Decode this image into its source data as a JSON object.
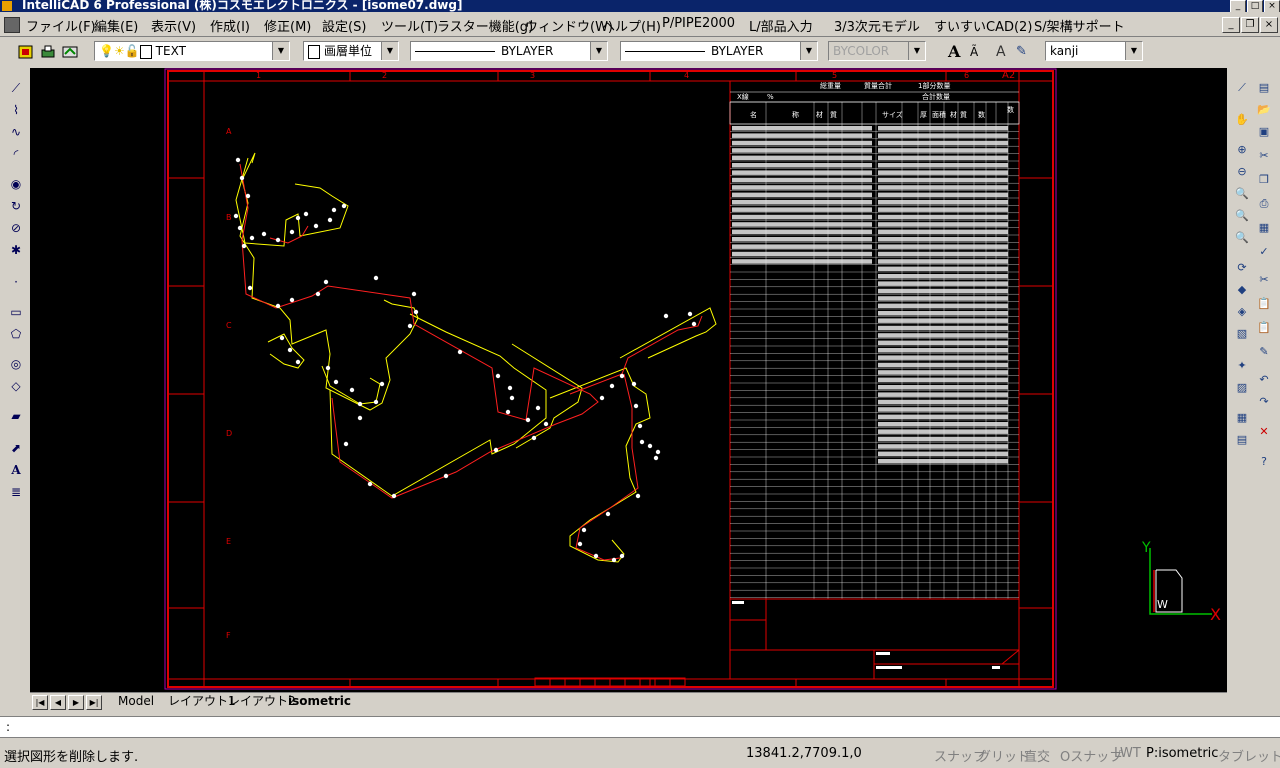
{
  "window": {
    "title": "IntelliCAD 6 Professional (株)コスモエレクトロニクス - [isome07.dwg]"
  },
  "menu": [
    "ファイル(F)",
    "編集(E)",
    "表示(V)",
    "作成(I)",
    "修正(M)",
    "設定(S)",
    "ツール(T)",
    "ラスター機能(g)",
    "ウィンドウ(W)",
    "ヘルプ(H)",
    "P/PIPE2000",
    "L/部品入力",
    "3/3次元モデル",
    "すいすいCAD(2)",
    "S/架構サポート"
  ],
  "toolbar": {
    "layer": "TEXT",
    "layer_unit": "画層単位",
    "linetype": "BYLAYER",
    "lineweight": "BYLAYER",
    "color": "BYCOLOR",
    "font": "kanji"
  },
  "drawing": {
    "border_letters": [
      "A",
      "B",
      "C",
      "D",
      "E",
      "F"
    ],
    "border_numbers": [
      "1",
      "2",
      "3",
      "4",
      "5",
      "6"
    ],
    "sheet_label": "A2",
    "table_headers": [
      "名",
      "称",
      "材",
      "質",
      "サイズ",
      "厚",
      "面積",
      "材",
      "質",
      "数",
      "数"
    ],
    "table_header_small": [
      "X線",
      "%"
    ],
    "title_block_labels": [
      "総重量",
      "質量合計",
      "1部分数量",
      "合計数量"
    ],
    "ucs": {
      "x": "X",
      "y": "Y",
      "w": "W"
    }
  },
  "tabs": {
    "model": "Model",
    "layout1": "レイアウト1",
    "layout2": "レイアウト2",
    "active": "isometric"
  },
  "command": {
    "prompt": ":"
  },
  "status": {
    "message": "選択図形を削除します.",
    "coords": "13841.2,7709.1,0",
    "snap": "スナップ",
    "grid": "グリッド",
    "ortho": "直交",
    "osnap": "Oスナップ",
    "lwt": "LWT",
    "space": "P:isometric",
    "tablet": "タブレット"
  }
}
